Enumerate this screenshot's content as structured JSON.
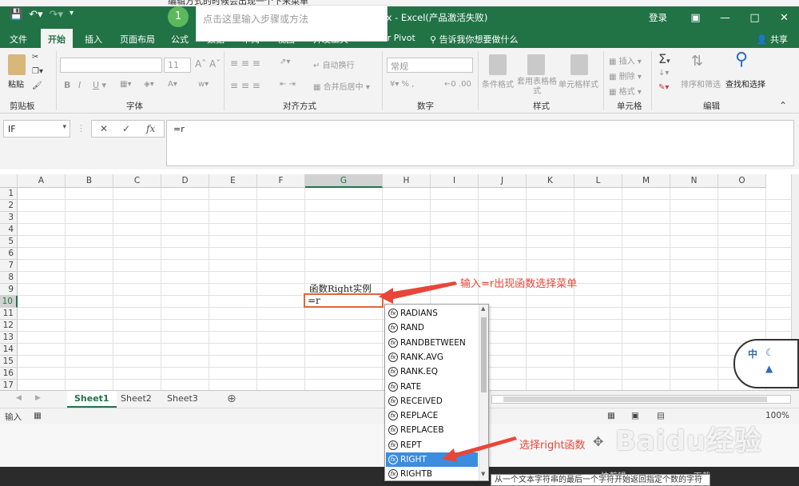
{
  "webpage_top_text": "编辑方式的时候会出现一个下来菜单",
  "window": {
    "title": "right函数.xlsx  -  Excel(产品激活失败)",
    "login": "登录"
  },
  "tabs": [
    "文件",
    "开始",
    "插入",
    "页面布局",
    "公式",
    "数据",
    "审阅",
    "视图",
    "开发工具",
    "Power Pivot",
    "告诉我你想要做什么"
  ],
  "share": "共享",
  "ribbon": {
    "paste": "粘贴",
    "font_size": "11",
    "wrap_text": "自动换行",
    "merge_center": "合并后居中",
    "number_format": "常规",
    "conditional_format": "条件格式",
    "table_format": "套用表格格式",
    "cell_style": "单元格样式",
    "insert": "插入",
    "delete": "删除",
    "format": "格式",
    "sort_filter": "排序和筛选",
    "find_select": "查找和选择",
    "groups": [
      "剪贴板",
      "字体",
      "对齐方式",
      "数字",
      "样式",
      "单元格",
      "编辑"
    ]
  },
  "formula_bar": {
    "name_box": "IF",
    "formula": "=r",
    "fx": "fx"
  },
  "columns": [
    "A",
    "B",
    "C",
    "D",
    "E",
    "F",
    "G",
    "H",
    "I",
    "J",
    "K",
    "L",
    "M",
    "N",
    "O"
  ],
  "rows": [
    "1",
    "2",
    "3",
    "4",
    "5",
    "6",
    "7",
    "8",
    "9",
    "10",
    "11",
    "12",
    "13",
    "14",
    "15",
    "16",
    "17"
  ],
  "cells": {
    "G9": "函数Right实例",
    "G10": "=r"
  },
  "sheets": [
    "Sheet1",
    "Sheet2",
    "Sheet3"
  ],
  "status": {
    "mode": "输入",
    "zoom": "100%"
  },
  "dropdown_items": [
    "RADIANS",
    "RAND",
    "RANDBETWEEN",
    "RANK.AVG",
    "RANK.EQ",
    "RATE",
    "RECEIVED",
    "REPLACE",
    "REPLACEB",
    "REPT",
    "RIGHT",
    "RIGHTB"
  ],
  "selected_item": "RIGHT",
  "tooltip": "从一个文本字符串的最后一个字符开始返回指定个数的字符",
  "annotations": {
    "first": "输入=r出现函数选择菜单",
    "second": "选择right函数"
  },
  "step": {
    "number": "1",
    "placeholder": "点击这里输入步骤或方法"
  },
  "taskbar": [
    "快剪辑",
    "下载"
  ],
  "watermark": "Baidu经验",
  "bubble_text": "中",
  "colors": {
    "excel_green": "#217346",
    "annotation_red": "#e8463a",
    "selection_blue": "#3c8ce0"
  }
}
